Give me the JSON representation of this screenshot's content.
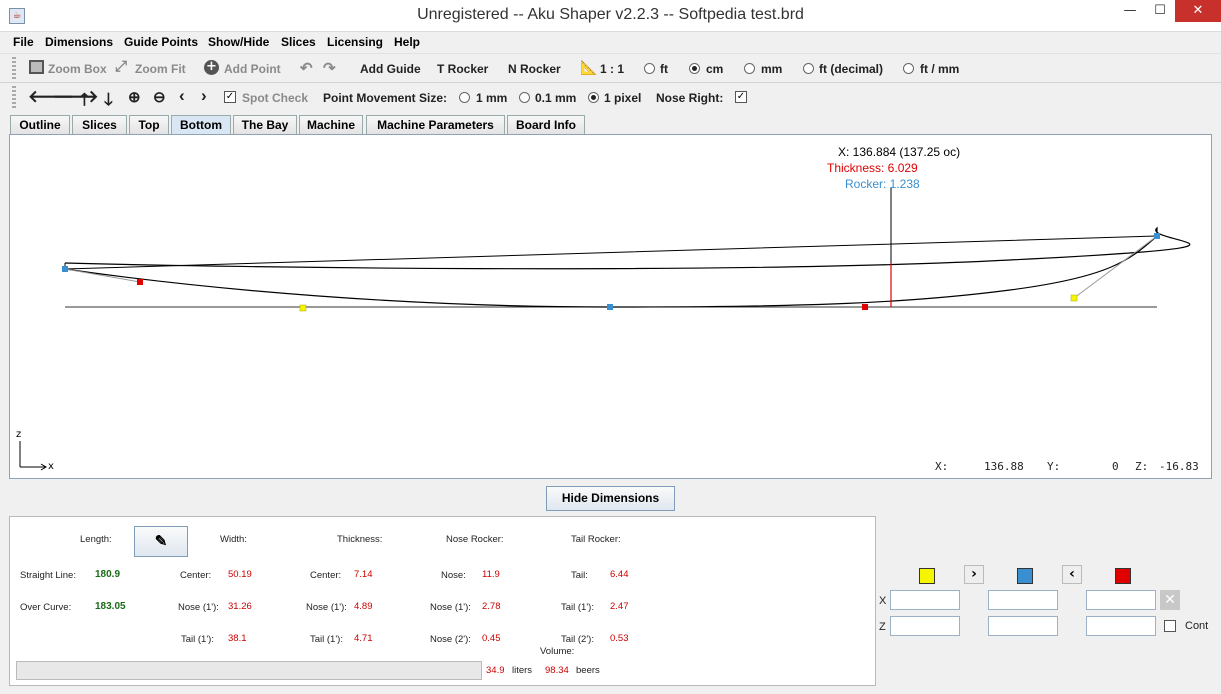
{
  "window": {
    "title": "Unregistered -- Aku Shaper v2.2.3  --  Softpedia test.brd",
    "minimize": "—",
    "maximize": "☐",
    "close": "✕"
  },
  "menubar": [
    "File",
    "Dimensions",
    "Guide Points",
    "Show/Hide",
    "Slices",
    "Licensing",
    "Help"
  ],
  "toolbar1": {
    "zoom_box": "Zoom Box",
    "zoom_fit": "Zoom Fit",
    "add_point": "Add Point",
    "add_guide": "Add Guide",
    "t_rocker": "T Rocker",
    "n_rocker": "N Rocker",
    "scale": "1 : 1",
    "units": [
      {
        "label": "ft",
        "selected": false
      },
      {
        "label": "cm",
        "selected": true
      },
      {
        "label": "mm",
        "selected": false
      },
      {
        "label": "ft (decimal)",
        "selected": false
      },
      {
        "label": "ft / mm",
        "selected": false
      }
    ]
  },
  "toolbar2": {
    "spot_check": "Spot Check",
    "movement_label": "Point Movement Size:",
    "movement": [
      {
        "label": "1 mm",
        "selected": false
      },
      {
        "label": "0.1 mm",
        "selected": false
      },
      {
        "label": "1 pixel",
        "selected": true
      }
    ],
    "nose_right_label": "Nose Right:",
    "nose_right_checked": true
  },
  "tabs": [
    {
      "label": "Outline"
    },
    {
      "label": "Slices"
    },
    {
      "label": "Top"
    },
    {
      "label": "Bottom",
      "active": true
    },
    {
      "label": "The Bay"
    },
    {
      "label": "Machine"
    },
    {
      "label": "Machine Parameters"
    },
    {
      "label": "Board Info"
    }
  ],
  "canvas": {
    "readout_x": "X: 136.884 (137.25 oc)",
    "readout_thickness": "Thickness: 6.029",
    "readout_rocker": "Rocker: 1.238",
    "axis_z": "z",
    "axis_x": "x",
    "status_x_label": "X:",
    "status_x": "136.88",
    "status_y_label": "Y:",
    "status_y": "0",
    "status_z_label": "Z:",
    "status_z": "-16.83",
    "colors": {
      "thickness": "#e00000",
      "rocker": "#3a8fd0",
      "yellow": "#f5f500",
      "blue": "#3a8fd0",
      "red": "#e00000"
    }
  },
  "hide_dimensions": "Hide Dimensions",
  "dimensions": {
    "length_label": "Length:",
    "width_label": "Width:",
    "thickness_label": "Thickness:",
    "nose_rocker_label": "Nose Rocker:",
    "tail_rocker_label": "Tail Rocker:",
    "straight_line_label": "Straight Line:",
    "straight_line": "180.9",
    "over_curve_label": "Over Curve:",
    "over_curve": "183.05",
    "width_center_label": "Center:",
    "width_center": "50.19",
    "width_nose_label": "Nose (1'):",
    "width_nose": "31.26",
    "width_tail_label": "Tail (1'):",
    "width_tail": "38.1",
    "thick_center_label": "Center:",
    "thick_center": "7.14",
    "thick_nose_label": "Nose (1'):",
    "thick_nose": "4.89",
    "thick_tail_label": "Tail (1'):",
    "thick_tail": "4.71",
    "nr_nose_label": "Nose:",
    "nr_nose": "11.9",
    "nr_nose1_label": "Nose (1'):",
    "nr_nose1": "2.78",
    "nr_nose2_label": "Nose (2'):",
    "nr_nose2": "0.45",
    "tr_tail_label": "Tail:",
    "tr_tail": "6.44",
    "tr_tail1_label": "Tail (1'):",
    "tr_tail1": "2.47",
    "tr_tail2_label": "Tail (2'):",
    "tr_tail2": "0.53",
    "volume_label": "Volume:",
    "volume_liters": "34.9",
    "liters_unit": "liters",
    "volume_beers": "98.34",
    "beers_unit": "beers"
  },
  "point_editor": {
    "x_label": "X",
    "z_label": "Z",
    "cont_label": "Cont",
    "cont_checked": false
  }
}
